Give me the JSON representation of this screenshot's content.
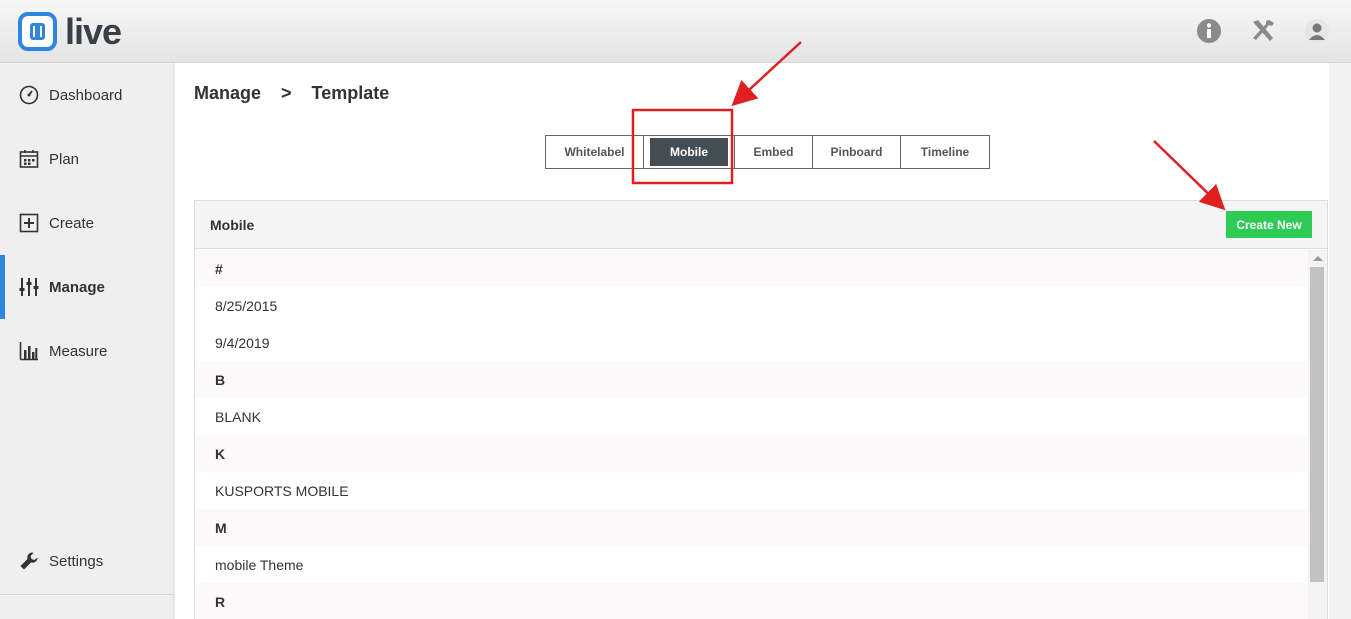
{
  "app": {
    "logo_text": "live"
  },
  "header": {
    "icons": [
      "info-icon",
      "tools-icon",
      "user-icon"
    ]
  },
  "sidebar": {
    "items": [
      {
        "label": "Dashboard",
        "icon": "dashboard-icon"
      },
      {
        "label": "Plan",
        "icon": "calendar-icon"
      },
      {
        "label": "Create",
        "icon": "plus-box-icon"
      },
      {
        "label": "Manage",
        "icon": "sliders-icon",
        "active": true
      },
      {
        "label": "Measure",
        "icon": "bar-chart-icon"
      },
      {
        "label": "Settings",
        "icon": "wrench-icon"
      }
    ],
    "active_color": "#2f86e0"
  },
  "breadcrumb": {
    "part1": "Manage",
    "sep": ">",
    "part2": "Template"
  },
  "tabs": [
    {
      "label": "Whitelabel"
    },
    {
      "label": "Mobile",
      "active": true
    },
    {
      "label": "Embed"
    },
    {
      "label": "Pinboard"
    },
    {
      "label": "Timeline"
    }
  ],
  "panel": {
    "title": "Mobile",
    "create_button": "Create New",
    "create_button_color": "#2ecc55"
  },
  "list": [
    {
      "type": "header",
      "text": "#"
    },
    {
      "type": "item",
      "text": "8/25/2015"
    },
    {
      "type": "item",
      "text": "9/4/2019"
    },
    {
      "type": "header",
      "text": "B"
    },
    {
      "type": "item",
      "text": "BLANK"
    },
    {
      "type": "header",
      "text": "K"
    },
    {
      "type": "item",
      "text": "KUSPORTS MOBILE"
    },
    {
      "type": "header",
      "text": "M"
    },
    {
      "type": "item",
      "text": "mobile Theme"
    },
    {
      "type": "header",
      "text": "R"
    }
  ],
  "annotation_color": "#e02020"
}
